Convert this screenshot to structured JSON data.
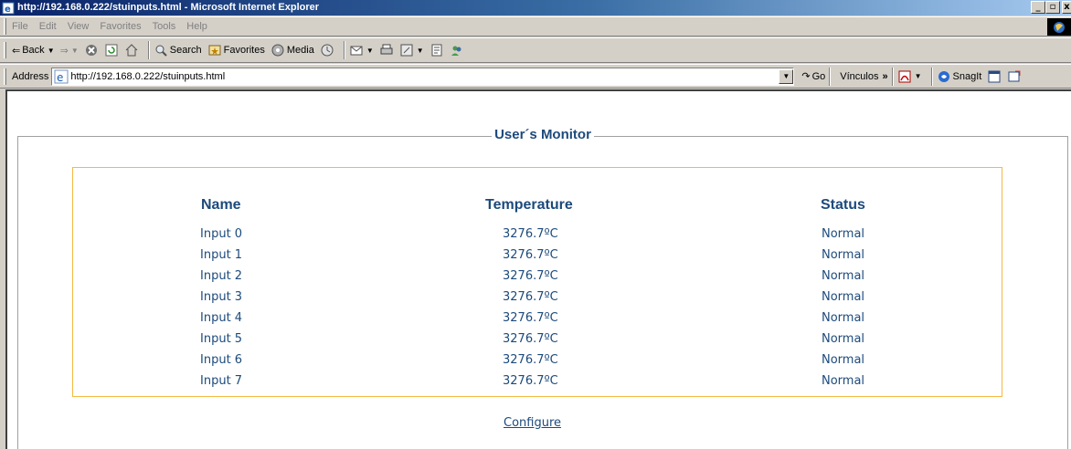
{
  "window": {
    "title": "http://192.168.0.222/stuinputs.html - Microsoft Internet Explorer",
    "minimize": "_",
    "maximize": "▫",
    "close": "x"
  },
  "menu": {
    "items": [
      "File",
      "Edit",
      "View",
      "Favorites",
      "Tools",
      "Help"
    ]
  },
  "toolbar": {
    "back_label": "Back",
    "search_label": "Search",
    "favorites_label": "Favorites",
    "media_label": "Media"
  },
  "address": {
    "label": "Address",
    "url": "http://192.168.0.222/stuinputs.html",
    "go_label": "Go",
    "links_label": "Vínculos",
    "snagit_label": "SnagIt"
  },
  "page": {
    "legend": "User´s Monitor",
    "headers": {
      "name": "Name",
      "temperature": "Temperature",
      "status": "Status"
    },
    "rows": [
      {
        "name": "Input 0",
        "temperature": "3276.7ºC",
        "status": "Normal"
      },
      {
        "name": "Input 1",
        "temperature": "3276.7ºC",
        "status": "Normal"
      },
      {
        "name": "Input 2",
        "temperature": "3276.7ºC",
        "status": "Normal"
      },
      {
        "name": "Input 3",
        "temperature": "3276.7ºC",
        "status": "Normal"
      },
      {
        "name": "Input 4",
        "temperature": "3276.7ºC",
        "status": "Normal"
      },
      {
        "name": "Input 5",
        "temperature": "3276.7ºC",
        "status": "Normal"
      },
      {
        "name": "Input 6",
        "temperature": "3276.7ºC",
        "status": "Normal"
      },
      {
        "name": "Input 7",
        "temperature": "3276.7ºC",
        "status": "Normal"
      }
    ],
    "configure_link": "Configure"
  },
  "colors": {
    "text_blue": "#1c4a7c",
    "table_border": "#f5b942",
    "title_gradient_start": "#0a246a",
    "title_gradient_end": "#a6caf0"
  }
}
